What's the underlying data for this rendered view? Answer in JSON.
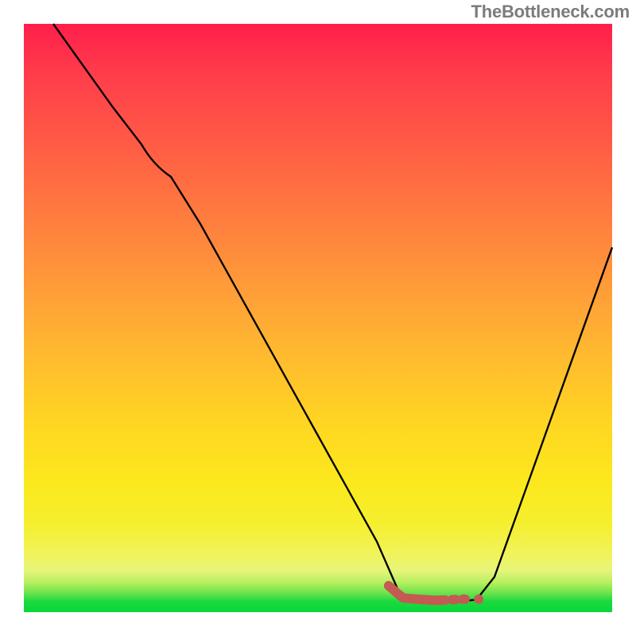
{
  "watermark": "TheBottleneck.com",
  "chart_data": {
    "type": "line",
    "title": "",
    "xlabel": "",
    "ylabel": "",
    "xlim": [
      0,
      100
    ],
    "ylim": [
      0,
      100
    ],
    "background_gradient_stops": [
      {
        "pos": 0,
        "color": "#ff1f4b"
      },
      {
        "pos": 8,
        "color": "#ff3b4b"
      },
      {
        "pos": 20,
        "color": "#ff5a45"
      },
      {
        "pos": 32,
        "color": "#ff7a3f"
      },
      {
        "pos": 44,
        "color": "#ff9a39"
      },
      {
        "pos": 56,
        "color": "#ffb930"
      },
      {
        "pos": 68,
        "color": "#ffd622"
      },
      {
        "pos": 78,
        "color": "#fce81e"
      },
      {
        "pos": 85,
        "color": "#f5ef2e"
      },
      {
        "pos": 90,
        "color": "#f1f35a"
      },
      {
        "pos": 93,
        "color": "#e6f47a"
      },
      {
        "pos": 95,
        "color": "#b5ef5e"
      },
      {
        "pos": 97,
        "color": "#5fe24a"
      },
      {
        "pos": 98.2,
        "color": "#1bd93f"
      },
      {
        "pos": 100,
        "color": "#08d83a"
      }
    ],
    "series": [
      {
        "name": "black-curve",
        "color": "#000000",
        "stroke_width": 2,
        "x": [
          5,
          10,
          15,
          20,
          25,
          30,
          35,
          40,
          45,
          50,
          55,
          60,
          63.5,
          65.5,
          70,
          75,
          77,
          80,
          85,
          90,
          95,
          100
        ],
        "y": [
          100,
          93,
          86,
          79.5,
          74,
          66,
          57,
          48,
          39,
          30,
          21,
          12,
          4,
          2.2,
          2,
          2,
          2.2,
          6,
          20,
          34,
          48,
          62
        ]
      },
      {
        "name": "red-dashed-bottom-segment",
        "color": "#c45a52",
        "stroke_width": 12,
        "style": "dashed-with-solid-heads",
        "x": [
          62,
          63.5,
          64.5,
          67,
          70,
          72,
          73.5,
          75
        ],
        "y": [
          4.5,
          3.2,
          2.4,
          2.2,
          2,
          2,
          2,
          2.2
        ]
      }
    ],
    "minimum_point": {
      "x": 71,
      "y": 2
    },
    "colors": {
      "curve": "#000000",
      "accent_segment": "#c45a52",
      "top": "#ff1f4b",
      "bottom": "#08d83a"
    }
  }
}
